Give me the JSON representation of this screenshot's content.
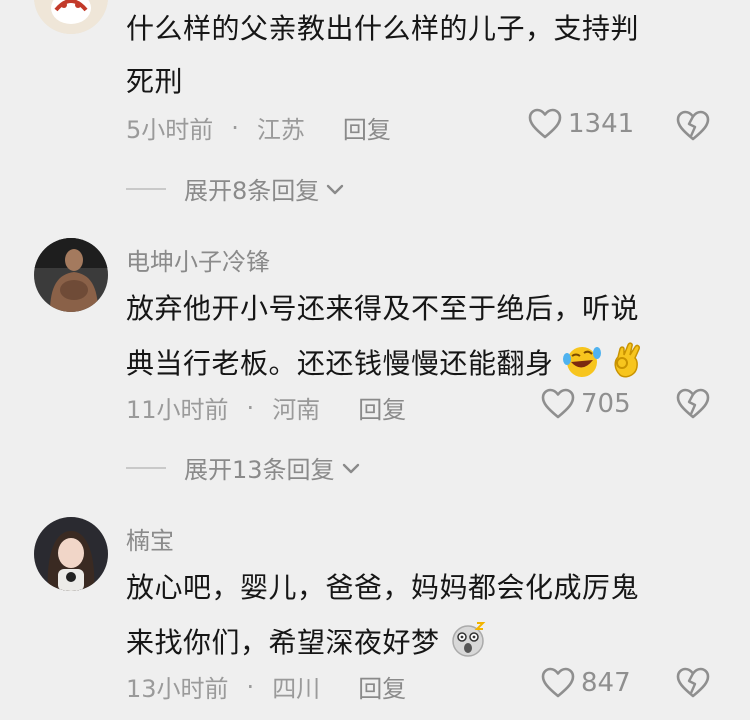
{
  "comments": [
    {
      "username": "",
      "text_line1": "什么样的父亲教出什么样的儿子，支持判",
      "text_line2": "死刑",
      "time": "5小时前",
      "separator": "·",
      "location": "江苏",
      "reply": "回复",
      "likes": "1341",
      "expand": "展开8条回复"
    },
    {
      "username": "电坤小子冷锋",
      "text_line1": "放弃他开小号还来得及不至于绝后，听说",
      "text_line2": "典当行老板。还还钱慢慢还能翻身",
      "time": "11小时前",
      "separator": "·",
      "location": "河南",
      "reply": "回复",
      "likes": "705",
      "expand": "展开13条回复"
    },
    {
      "username": "楠宝",
      "text_line1": "放心吧，婴儿，爸爸，妈妈都会化成厉鬼",
      "text_line2": "来找你们，希望深夜好梦",
      "time": "13小时前",
      "separator": "·",
      "location": "四川",
      "reply": "回复",
      "likes": "847"
    }
  ],
  "icons": {
    "like": "heart-outline-icon",
    "dislike": "broken-heart-icon",
    "expand": "chevron-down-icon",
    "emoji_laugh": "laughing-tears-emoji",
    "emoji_ok": "ok-hand-emoji",
    "emoji_shock": "shocked-face-emoji"
  },
  "colors": {
    "background": "#efefef",
    "text": "#161616",
    "secondary": "#8a8a8a"
  }
}
